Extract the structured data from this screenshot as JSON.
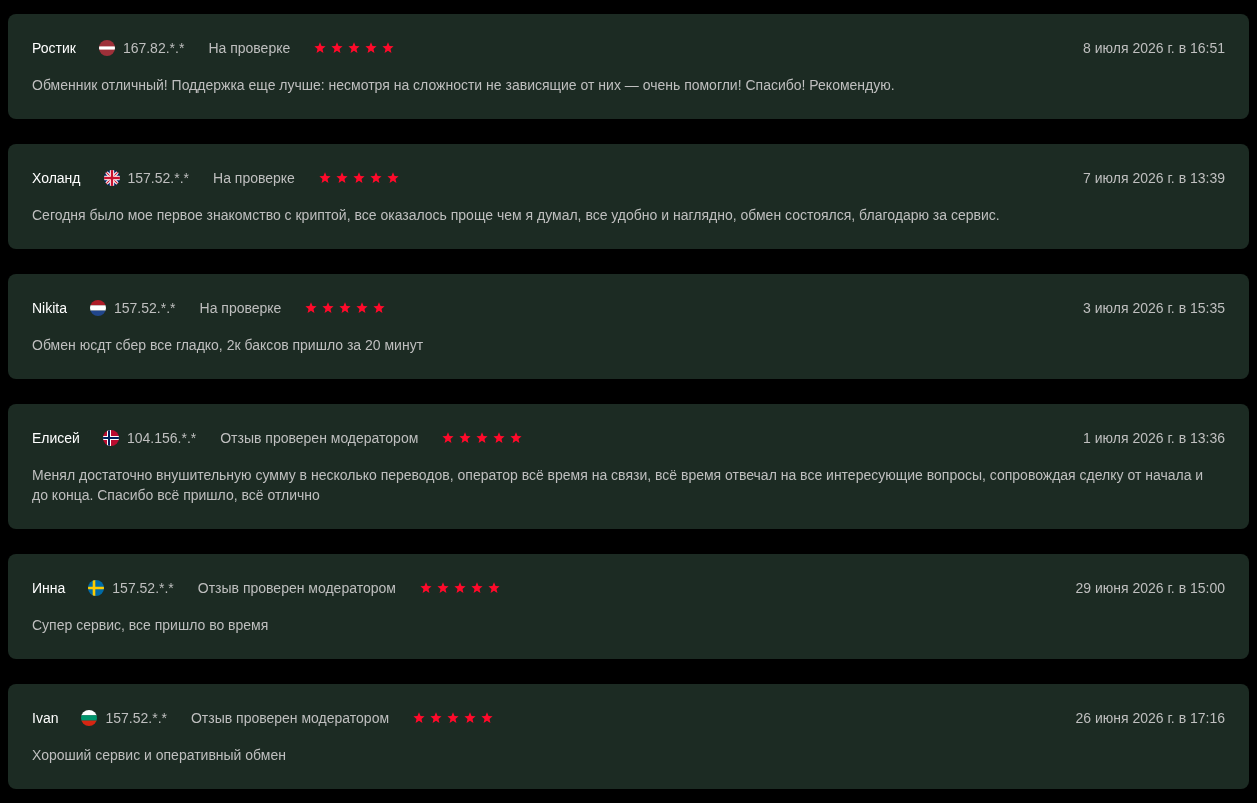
{
  "reviews": [
    {
      "name": "Ростик",
      "flag": {
        "kind": "lv"
      },
      "ip": "167.82.*.*",
      "status": "На проверке",
      "stars": 5,
      "date": "8 июля 2026 г. в 16:51",
      "text": "Обменник отличный! Поддержка еще лучше: несмотря на сложности не зависящие от них — очень помогли! Спасибо! Рекомендую."
    },
    {
      "name": "Холанд",
      "flag": {
        "kind": "gb"
      },
      "ip": "157.52.*.*",
      "status": "На проверке",
      "stars": 5,
      "date": "7 июля 2026 г. в 13:39",
      "text": "Сегодня было мое первое знакомство с криптой, все оказалось проще чем я думал, все удобно и наглядно, обмен состоялся, благодарю за сервис."
    },
    {
      "name": "Nikita",
      "flag": {
        "kind": "nl"
      },
      "ip": "157.52.*.*",
      "status": "На проверке",
      "stars": 5,
      "date": "3 июля 2026 г. в 15:35",
      "text": "Обмен юсдт сбер все гладко, 2к баксов пришло за 20 минут"
    },
    {
      "name": "Елисей",
      "flag": {
        "kind": "no"
      },
      "ip": "104.156.*.*",
      "status": "Отзыв проверен модератором",
      "stars": 5,
      "date": "1 июля 2026 г. в 13:36",
      "text": "Менял достаточно внушительную сумму в несколько переводов, оператор всё время на связи, всё время отвечал на все интересующие вопросы, сопровождая сделку от начала и до конца. Спасибо всё пришло, всё отлично"
    },
    {
      "name": "Инна",
      "flag": {
        "kind": "se"
      },
      "ip": "157.52.*.*",
      "status": "Отзыв проверен модератором",
      "stars": 5,
      "date": "29 июня 2026 г. в 15:00",
      "text": "Супер сервис, все пришло во время"
    },
    {
      "name": "Ivan",
      "flag": {
        "kind": "bg"
      },
      "ip": "157.52.*.*",
      "status": "Отзыв проверен модератором",
      "stars": 5,
      "date": "26 июня 2026 г. в 17:16",
      "text": "Хороший сервис и оперативный обмен"
    }
  ]
}
